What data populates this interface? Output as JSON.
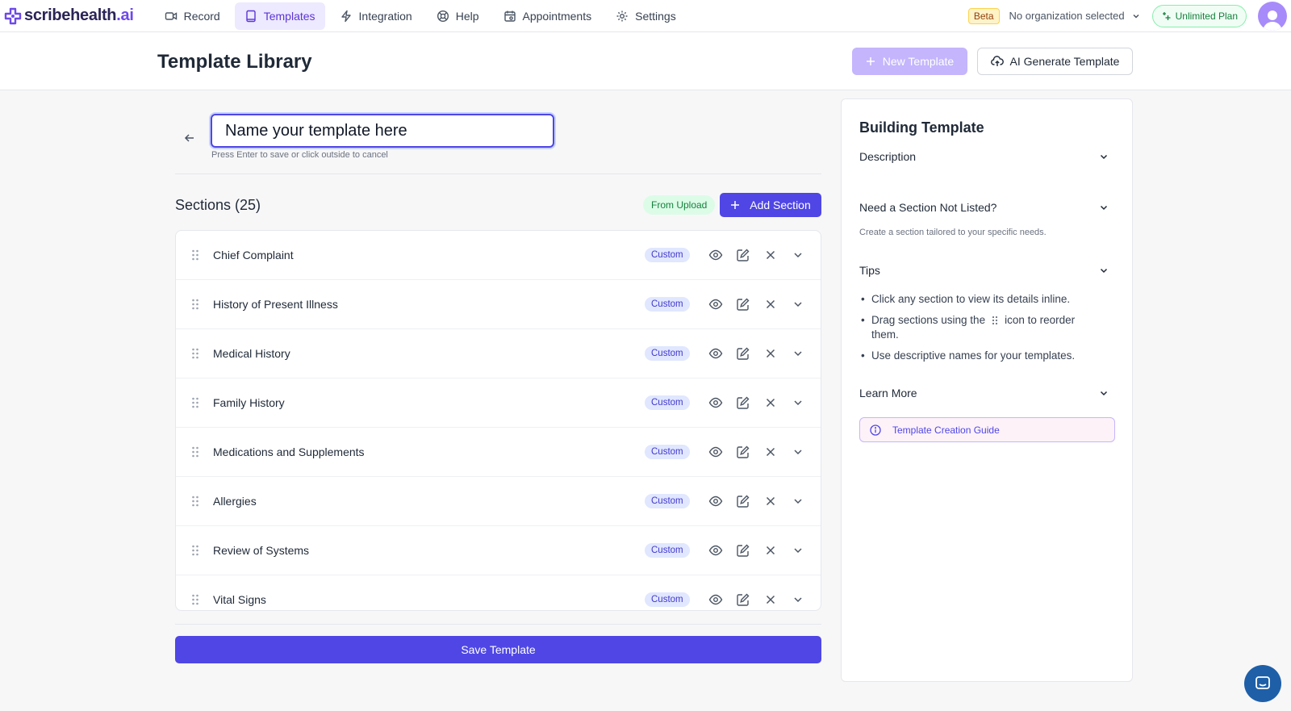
{
  "brand": {
    "name": "scribehealth",
    "suffix": ".ai"
  },
  "nav": {
    "items": [
      {
        "label": "Record",
        "icon": "video-icon",
        "active": false
      },
      {
        "label": "Templates",
        "icon": "book-icon",
        "active": true
      },
      {
        "label": "Integration",
        "icon": "bolt-icon",
        "active": false
      },
      {
        "label": "Help",
        "icon": "lifebuoy-icon",
        "active": false
      },
      {
        "label": "Appointments",
        "icon": "calendar-icon",
        "active": false
      },
      {
        "label": "Settings",
        "icon": "gear-icon",
        "active": false
      }
    ],
    "beta": "Beta",
    "organization": "No organization selected",
    "plan": "Unlimited Plan"
  },
  "header": {
    "title": "Template Library",
    "new_template": "New Template",
    "ai_generate": "AI Generate Template"
  },
  "editor": {
    "name_placeholder": "Name your template here",
    "hint": "Press Enter to save or click outside to cancel",
    "sections_title": "Sections (25)",
    "from_upload": "From Upload",
    "add_section": "Add Section",
    "save": "Save Template",
    "sections": [
      {
        "label": "Chief Complaint",
        "tag": "Custom"
      },
      {
        "label": "History of Present Illness",
        "tag": "Custom"
      },
      {
        "label": "Medical History",
        "tag": "Custom"
      },
      {
        "label": "Family History",
        "tag": "Custom"
      },
      {
        "label": "Medications and Supplements",
        "tag": "Custom"
      },
      {
        "label": "Allergies",
        "tag": "Custom"
      },
      {
        "label": "Review of Systems",
        "tag": "Custom"
      },
      {
        "label": "Vital Signs",
        "tag": "Custom"
      }
    ]
  },
  "panel": {
    "title": "Building Template",
    "description": "Description",
    "need_section": "Need a Section Not Listed?",
    "need_section_note": "Create a section tailored to your specific needs.",
    "tips_title": "Tips",
    "tips": {
      "tip1": "Click any section to view its details inline.",
      "tip2_before": "Drag sections using the",
      "tip2_after": "icon to reorder them.",
      "tip3": "Use descriptive names for your templates."
    },
    "learn_more": "Learn More",
    "guide": "Template Creation Guide"
  },
  "colors": {
    "primary": "#4f46e5",
    "primary_light": "#c4b5fd",
    "nav_active_bg": "#ede9fe",
    "plan_green": "#15803d",
    "custom_badge_bg": "#e0e7ff"
  }
}
